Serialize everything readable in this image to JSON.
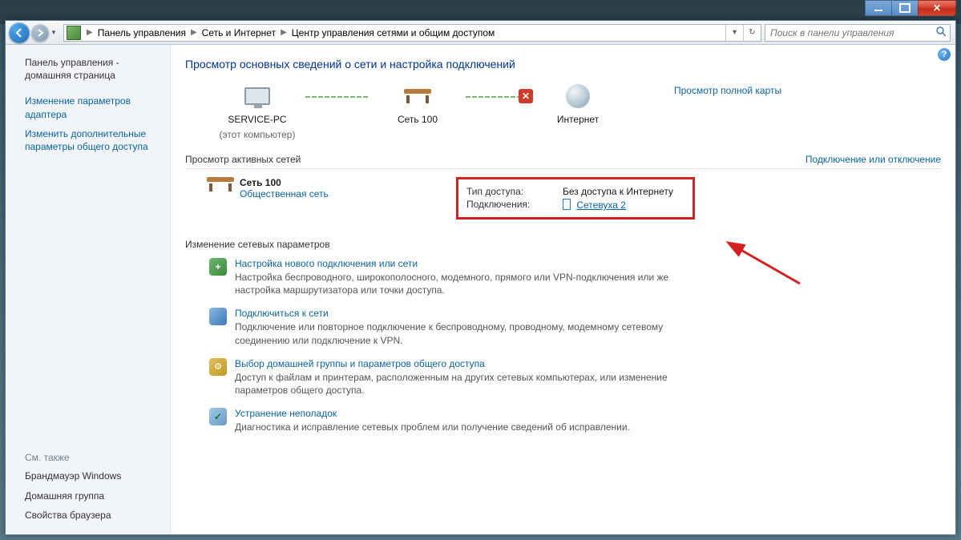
{
  "breadcrumb": {
    "level1": "Панель управления",
    "level2": "Сеть и Интернет",
    "level3": "Центр управления сетями и общим доступом"
  },
  "search": {
    "placeholder": "Поиск в панели управления"
  },
  "sidebar": {
    "home": "Панель управления - домашняя страница",
    "link1": "Изменение параметров адаптера",
    "link2": "Изменить дополнительные параметры общего доступа",
    "see_also": "См. также",
    "fw": "Брандмауэр Windows",
    "hg": "Домашняя группа",
    "bp": "Свойства браузера"
  },
  "page_title": "Просмотр основных сведений о сети и настройка подключений",
  "map": {
    "pc_name": "SERVICE-PC",
    "pc_sub": "(этот компьютер)",
    "net_name": "Сеть  100",
    "internet": "Интернет",
    "full_map_link": "Просмотр полной карты"
  },
  "active_section": {
    "title": "Просмотр активных сетей",
    "link": "Подключение или отключение"
  },
  "active_net": {
    "name": "Сеть  100",
    "type": "Общественная сеть",
    "access_label": "Тип доступа:",
    "access_value": "Без доступа к Интернету",
    "conn_label": "Подключения:",
    "conn_value": "Сетевуха 2"
  },
  "settings_header": "Изменение сетевых параметров",
  "tasks": [
    {
      "title": "Настройка нового подключения или сети",
      "desc": "Настройка беспроводного, широкополосного, модемного, прямого или VPN-подключения или же настройка маршрутизатора или точки доступа."
    },
    {
      "title": "Подключиться к сети",
      "desc": "Подключение или повторное подключение к беспроводному, проводному, модемному сетевому соединению или подключение к VPN."
    },
    {
      "title": "Выбор домашней группы и параметров общего доступа",
      "desc": "Доступ к файлам и принтерам, расположенным на других сетевых компьютерах, или изменение параметров общего доступа."
    },
    {
      "title": "Устранение неполадок",
      "desc": "Диагностика и исправление сетевых проблем или получение сведений об исправлении."
    }
  ]
}
